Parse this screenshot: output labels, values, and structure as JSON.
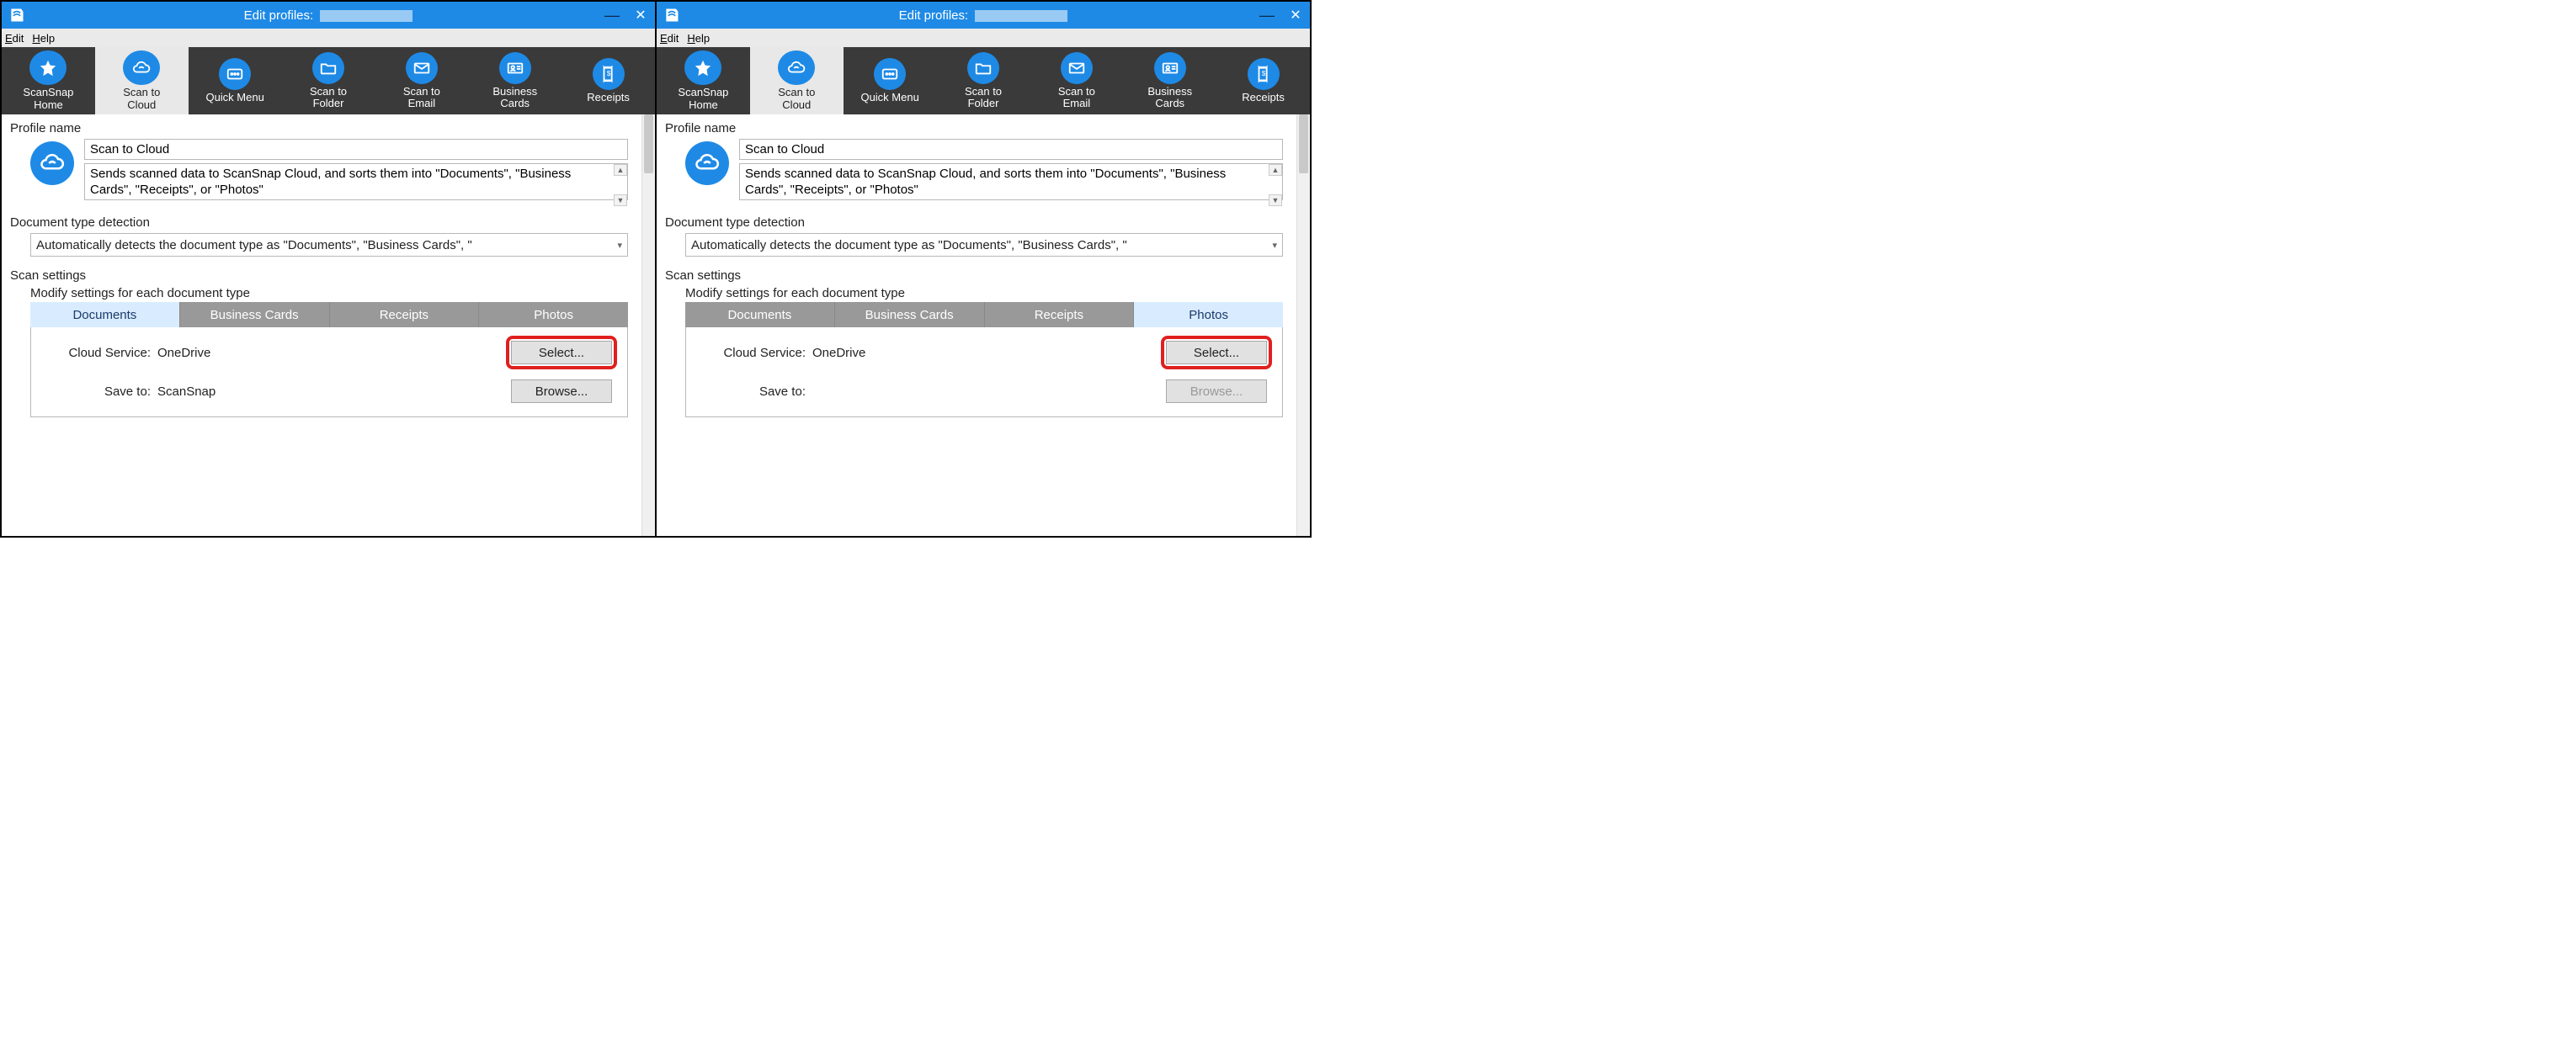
{
  "title_prefix": "Edit profiles:",
  "menu": {
    "edit": "Edit",
    "help": "Help"
  },
  "toolbar": [
    {
      "id": "home",
      "label": "ScanSnap\nHome",
      "icon": "star"
    },
    {
      "id": "cloud",
      "label": "Scan to\nCloud",
      "icon": "cloud",
      "selected": true
    },
    {
      "id": "quick",
      "label": "Quick Menu",
      "icon": "grid"
    },
    {
      "id": "folder",
      "label": "Scan to\nFolder",
      "icon": "folder"
    },
    {
      "id": "email",
      "label": "Scan to\nEmail",
      "icon": "mail"
    },
    {
      "id": "bcard",
      "label": "Business\nCards",
      "icon": "card"
    },
    {
      "id": "rcpt",
      "label": "Receipts",
      "icon": "receipt"
    }
  ],
  "sections": {
    "profile_name": "Profile name",
    "doc_type": "Document type detection",
    "scan_settings": "Scan settings",
    "modify": "Modify settings for each document type"
  },
  "profile": {
    "name": "Scan to Cloud",
    "desc": "Sends scanned data to ScanSnap Cloud, and sorts them into \"Documents\", \"Business Cards\", \"Receipts\", or \"Photos\""
  },
  "detect_option": "Automatically detects the document type as \"Documents\", \"Business Cards\", \"",
  "tabs": [
    "Documents",
    "Business Cards",
    "Receipts",
    "Photos"
  ],
  "form": {
    "cloud_label": "Cloud Service:",
    "save_label": "Save to:",
    "select_btn": "Select...",
    "browse_btn": "Browse..."
  },
  "left": {
    "active_tab": 0,
    "cloud_value": "OneDrive",
    "save_value": "ScanSnap",
    "browse_enabled": true
  },
  "right": {
    "active_tab": 3,
    "cloud_value": "OneDrive",
    "save_value": "",
    "browse_enabled": false
  }
}
